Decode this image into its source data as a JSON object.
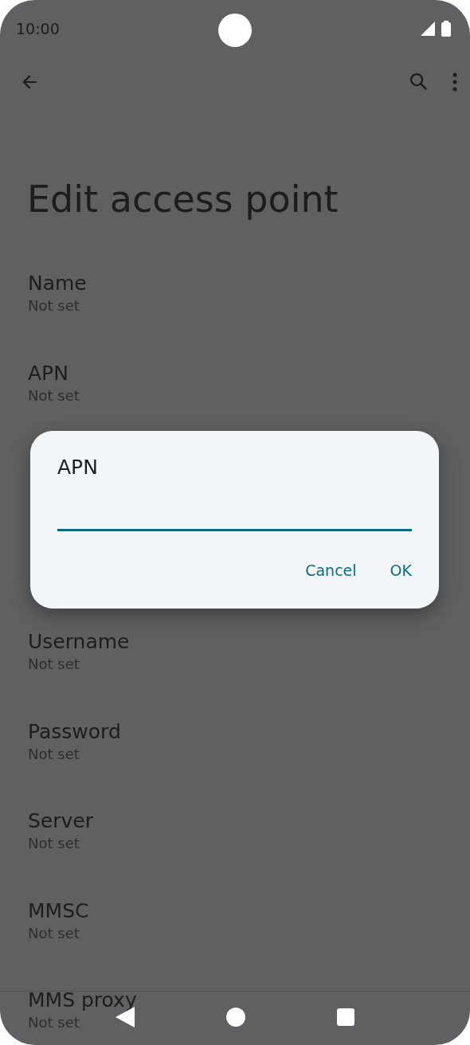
{
  "status_bar": {
    "time": "10:00"
  },
  "title": "Edit access point",
  "settings_above_dialog": [
    {
      "title": "Name",
      "summary": "Not set"
    },
    {
      "title": "APN",
      "summary": "Not set"
    }
  ],
  "settings_below_dialog": [
    {
      "title": "Username",
      "summary": "Not set"
    },
    {
      "title": "Password",
      "summary": "Not set"
    },
    {
      "title": "Server",
      "summary": "Not set"
    },
    {
      "title": "MMSC",
      "summary": "Not set"
    },
    {
      "title": "MMS proxy",
      "summary": "Not set"
    }
  ],
  "dialog": {
    "title": "APN",
    "field": {
      "focused": true
    },
    "buttons": [
      "Cancel",
      "OK"
    ]
  }
}
